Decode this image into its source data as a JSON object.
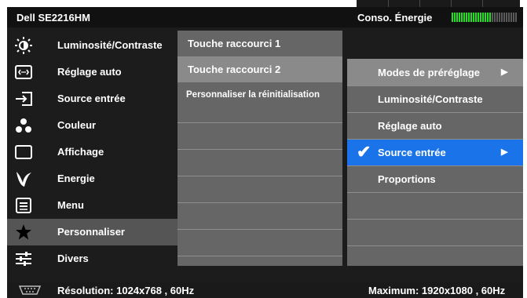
{
  "header": {
    "model": "Dell  SE2216HM",
    "energy_label": "Conso. Énergie",
    "energy_level": 0.6
  },
  "menu": {
    "items": [
      {
        "label": "Luminosité/Contraste",
        "icon": "brightness-icon"
      },
      {
        "label": "Réglage auto",
        "icon": "auto-adjust-icon"
      },
      {
        "label": "Source entrée",
        "icon": "input-source-icon"
      },
      {
        "label": "Couleur",
        "icon": "color-dots-icon"
      },
      {
        "label": "Affichage",
        "icon": "display-icon"
      },
      {
        "label": "Energie",
        "icon": "energy-leaf-icon"
      },
      {
        "label": "Menu",
        "icon": "menu-icon"
      },
      {
        "label": "Personnaliser",
        "icon": "star-icon"
      },
      {
        "label": "Divers",
        "icon": "sliders-icon"
      }
    ],
    "selected_index": 7
  },
  "submenu": {
    "items": [
      {
        "label": "Touche raccourci 1"
      },
      {
        "label": "Touche raccourci 2"
      },
      {
        "label": "Personnaliser la réinitialisation"
      }
    ],
    "active_index": 1
  },
  "options": {
    "items": [
      {
        "label": "Modes de préréglage",
        "arrow": "▶"
      },
      {
        "label": "Luminosité/Contraste",
        "arrow": ""
      },
      {
        "label": "Réglage auto",
        "arrow": ""
      },
      {
        "label": "Source entrée",
        "arrow": "▶",
        "check": "✔"
      },
      {
        "label": "Proportions",
        "arrow": ""
      }
    ],
    "selected_index": 3
  },
  "footer": {
    "resolution": "Résolution: 1024x768 , 60Hz",
    "maximum": "Maximum: 1920x1080 , 60Hz"
  },
  "colors": {
    "energy_fill": "#22e022",
    "energy_empty": "#5a5a5a",
    "selection_blue": "#1a73e8"
  }
}
